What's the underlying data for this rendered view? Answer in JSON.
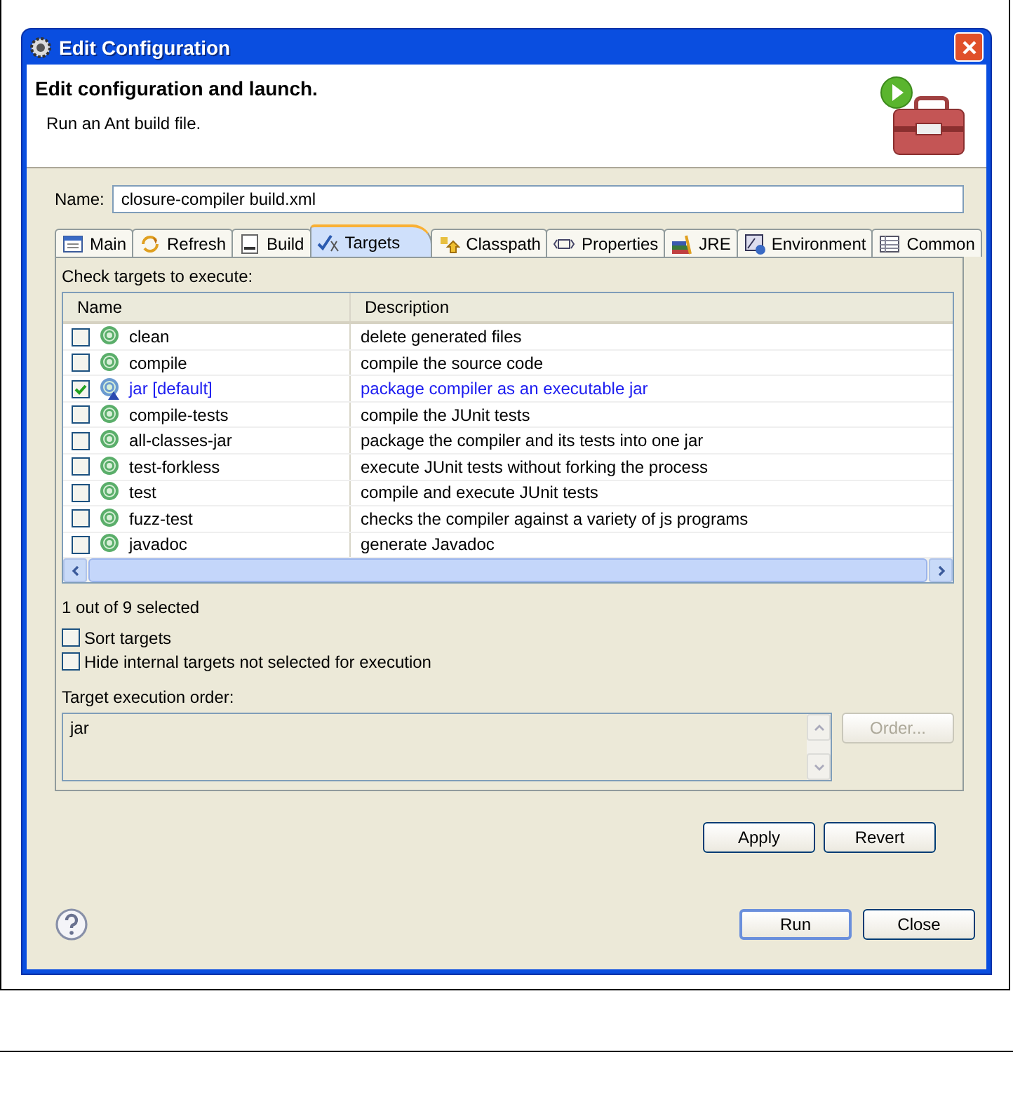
{
  "window": {
    "title": "Edit Configuration"
  },
  "header": {
    "title": "Edit configuration and launch.",
    "subtitle": "Run an Ant build file."
  },
  "name_field": {
    "label": "Name:",
    "value": "closure-compiler build.xml"
  },
  "tabs": [
    {
      "label": "Main",
      "selected": false
    },
    {
      "label": "Refresh",
      "selected": false
    },
    {
      "label": "Build",
      "selected": false
    },
    {
      "label": "Targets",
      "selected": true
    },
    {
      "label": "Classpath",
      "selected": false
    },
    {
      "label": "Properties",
      "selected": false
    },
    {
      "label": "JRE",
      "selected": false
    },
    {
      "label": "Environment",
      "selected": false
    },
    {
      "label": "Common",
      "selected": false
    }
  ],
  "targets": {
    "label": "Check targets to execute:",
    "columns": [
      "Name",
      "Description"
    ],
    "rows": [
      {
        "name": "clean",
        "description": "delete generated files",
        "checked": false,
        "is_default": false
      },
      {
        "name": "compile",
        "description": "compile the source code",
        "checked": false,
        "is_default": false
      },
      {
        "name": "jar [default]",
        "description": "package compiler as an executable jar",
        "checked": true,
        "is_default": true
      },
      {
        "name": "compile-tests",
        "description": "compile the JUnit tests",
        "checked": false,
        "is_default": false
      },
      {
        "name": "all-classes-jar",
        "description": "package the compiler and its tests into one jar",
        "checked": false,
        "is_default": false
      },
      {
        "name": "test-forkless",
        "description": "execute JUnit tests without forking the process",
        "checked": false,
        "is_default": false
      },
      {
        "name": "test",
        "description": "compile and execute JUnit tests",
        "checked": false,
        "is_default": false
      },
      {
        "name": "fuzz-test",
        "description": "checks the compiler against a variety of js programs",
        "checked": false,
        "is_default": false
      },
      {
        "name": "javadoc",
        "description": "generate Javadoc",
        "checked": false,
        "is_default": false
      }
    ],
    "count": "1 out of 9 selected"
  },
  "options": [
    {
      "label": "Sort targets",
      "checked": false
    },
    {
      "label": "Hide internal targets not selected for execution",
      "checked": false
    }
  ],
  "order": {
    "label": "Target execution order:",
    "value": "jar",
    "button": {
      "label": "Order...",
      "disabled": true
    }
  },
  "panel_buttons": [
    "Apply",
    "Revert"
  ],
  "dialog_buttons": [
    {
      "label": "Run",
      "default": true
    },
    {
      "label": "Close",
      "default": false
    }
  ]
}
